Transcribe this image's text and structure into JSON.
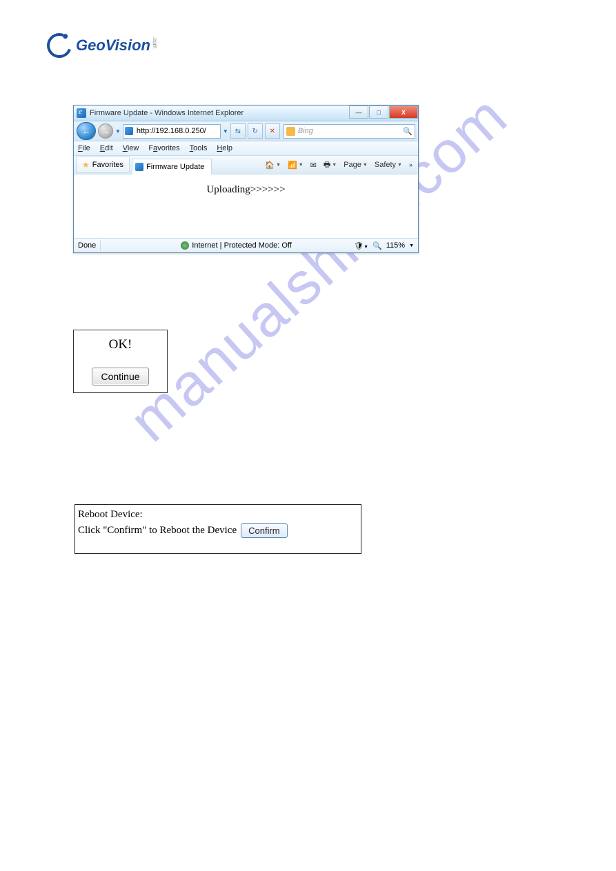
{
  "logo": {
    "text": "GeoVision",
    "tag": ".com"
  },
  "watermark": "manualshive.com",
  "ie": {
    "title": "Firmware Update - Windows Internet Explorer",
    "url": "http://192.168.0.250/",
    "search_engine": "Bing",
    "menu": {
      "file": "File",
      "edit": "Edit",
      "view": "View",
      "favorites": "Favorites",
      "tools": "Tools",
      "help": "Help"
    },
    "favorites_btn": "Favorites",
    "tab_title": "Firmware Update",
    "cmds": {
      "page": "Page",
      "safety": "Safety"
    },
    "content": "Uploading>>>>>>",
    "status": {
      "done": "Done",
      "zone": "Internet | Protected Mode: Off",
      "zoom": "115%"
    },
    "win": {
      "min": "—",
      "max": "□",
      "close": "X"
    }
  },
  "ok_box": {
    "label": "OK!",
    "button": "Continue"
  },
  "reboot": {
    "title": "Reboot Device:",
    "instruction": "Click \"Confirm\" to Reboot the Device",
    "button": "Confirm"
  }
}
